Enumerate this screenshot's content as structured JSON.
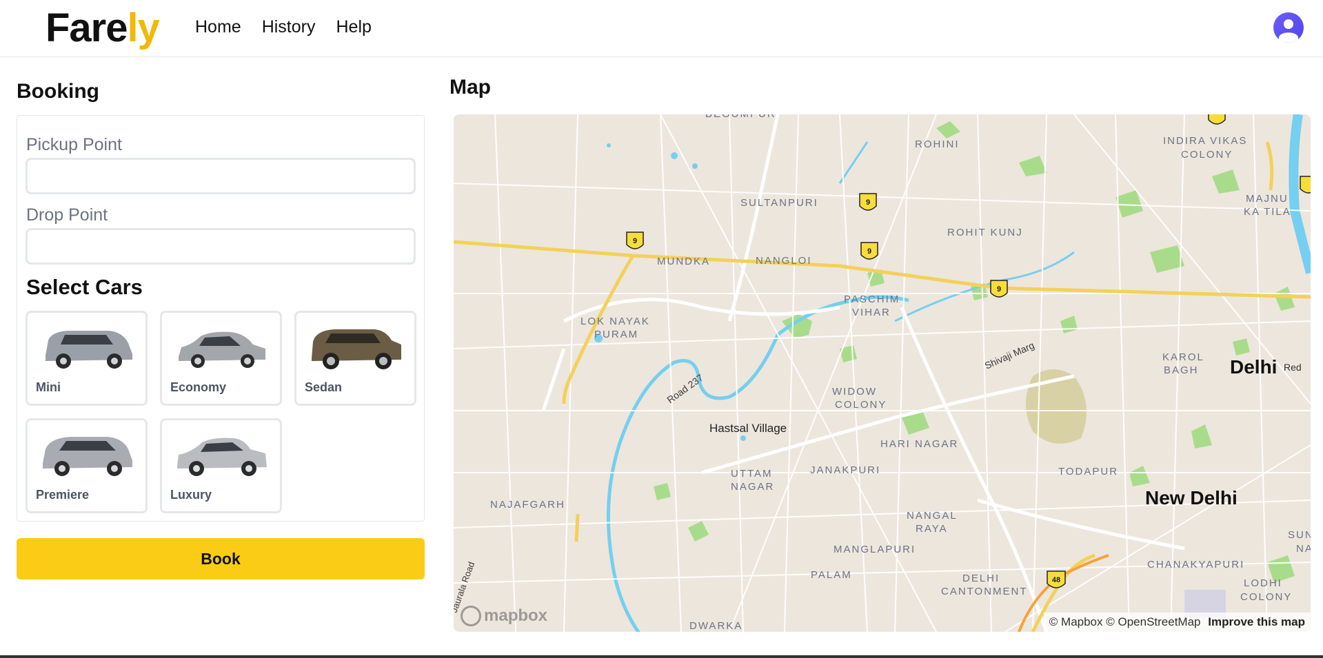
{
  "header": {
    "logo_part1": "Fare",
    "logo_part2": "ly",
    "nav": [
      "Home",
      "History",
      "Help"
    ]
  },
  "booking": {
    "title": "Booking",
    "pickup_label": "Pickup Point",
    "pickup_value": "",
    "drop_label": "Drop Point",
    "drop_value": "",
    "cars_title": "Select Cars",
    "cars": [
      {
        "name": "Mini",
        "color": "#9aa0a8"
      },
      {
        "name": "Economy",
        "color": "#a3a6aa"
      },
      {
        "name": "Sedan",
        "color": "#6b5d45"
      },
      {
        "name": "Premiere",
        "color": "#a8acb2"
      },
      {
        "name": "Luxury",
        "color": "#b9bcc0"
      }
    ],
    "book_label": "Book"
  },
  "map": {
    "title": "Map",
    "labels": {
      "rohini": "ROHINI",
      "indira_vikas_1": "INDIRA VIKAS",
      "indira_vikas_2": "COLONY",
      "sultanpuri": "SULTANPURI",
      "majnu_1": "MAJNU",
      "majnu_2": "KA TILA",
      "rohit_kunj": "ROHIT KUNJ",
      "mundka": "MUNDKA",
      "nangloi": "NANGLOI",
      "paschim_1": "PASCHIM",
      "paschim_2": "VIHAR",
      "lok_nayak_1": "LOK NAYAK",
      "lok_nayak_2": "PURAM",
      "shivaji_marg": "Shivaji Marg",
      "karol_1": "KAROL",
      "karol_2": "BAGH",
      "delhi": "Delhi",
      "red": "Red",
      "road237": "Road 237",
      "widow_1": "WIDOW",
      "widow_2": "COLONY",
      "hastsal": "Hastsal Village",
      "hari_nagar": "HARI NAGAR",
      "uttam_1": "UTTAM",
      "uttam_2": "NAGAR",
      "janakpuri": "JANAKPURI",
      "todapur": "TODAPUR",
      "new_delhi": "New Delhi",
      "najafgarh": "NAJAFGARH",
      "nangal_1": "NANGAL",
      "nangal_2": "RAYA",
      "manglapuri": "MANGLAPURI",
      "palam": "PALAM",
      "chanakyapuri": "CHANAKYAPURI",
      "su": "SUN",
      "na": "NA",
      "delhi_cant_1": "DELHI",
      "delhi_cant_2": "CANTONMENT",
      "lodhi_1": "LODHI",
      "lodhi_2": "COLONY",
      "dwarka": "DWARKA",
      "jaurala": "Jaurala Road",
      "begumpur": "BEGUMPUR",
      "shield_9": "9",
      "shield_48": "48"
    },
    "attribution": "© Mapbox © OpenStreetMap",
    "improve": "Improve this map",
    "logo_text": "mapbox",
    "colors": {
      "land": "#ede6dd",
      "park": "#a9dc8a",
      "water": "#75cff0",
      "highway": "#f3d15a",
      "road": "#ffffff"
    }
  }
}
